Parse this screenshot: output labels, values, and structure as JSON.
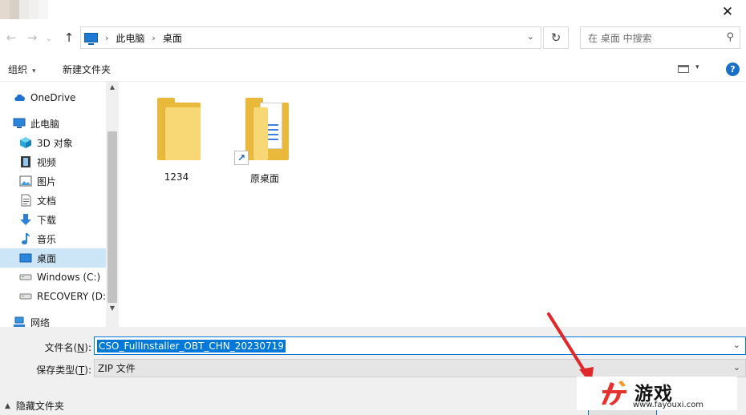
{
  "window": {
    "title_blur_colors": [
      "#e3d9cf",
      "#d8d0c7",
      "#ecebe8",
      "#f2f0ee",
      "#f6f6f6"
    ],
    "close_glyph": "✕"
  },
  "address_bar": {
    "back_glyph": "←",
    "forward_glyph": "→",
    "recent_glyph": "⌄",
    "up_glyph": "↑",
    "path": [
      "此电脑",
      "桌面"
    ],
    "separator": "›",
    "dropdown_glyph": "⌄",
    "refresh_glyph": "↻"
  },
  "search": {
    "placeholder": "在 桌面 中搜索",
    "icon": "search-icon",
    "icon_glyph": "⚲"
  },
  "toolbar": {
    "organize_label": "组织",
    "organize_caret": "▾",
    "new_folder_label": "新建文件夹",
    "view_caret": "▾",
    "help_glyph": "?"
  },
  "nav_pane": {
    "items": [
      {
        "label": "OneDrive",
        "icon": "cloud-icon"
      },
      {
        "label": "此电脑",
        "icon": "computer-icon"
      },
      {
        "label": "3D 对象",
        "icon": "3d-objects-icon"
      },
      {
        "label": "视频",
        "icon": "video-icon"
      },
      {
        "label": "图片",
        "icon": "pictures-icon"
      },
      {
        "label": "文档",
        "icon": "documents-icon"
      },
      {
        "label": "下载",
        "icon": "download-icon"
      },
      {
        "label": "音乐",
        "icon": "music-icon"
      },
      {
        "label": "桌面",
        "icon": "desktop-icon",
        "selected": true
      },
      {
        "label": "Windows (C:)",
        "icon": "drive-icon"
      },
      {
        "label": "RECOVERY (D:)",
        "icon": "drive-icon"
      },
      {
        "label": "网络",
        "icon": "network-icon"
      }
    ],
    "scroll_up_glyph": "▲",
    "scroll_down_glyph": "▼"
  },
  "files": [
    {
      "name": "1234",
      "icon": "folder-icon"
    },
    {
      "name": "原桌面",
      "icon": "folder-shortcut-icon",
      "shortcut_glyph": "↗"
    }
  ],
  "form": {
    "filename_label": "文件名(",
    "filename_key": "N",
    "filename_label_end": "):",
    "filename_value": "CSO_FullInstaller_OBT_CHN_20230719",
    "type_label": "保存类型(",
    "type_key": "T",
    "type_label_end": "):",
    "type_value": "ZIP 文件",
    "caret_glyph": "⌄",
    "hide_folders_caret": "▲",
    "hide_folders_label": "隐藏文件夹"
  },
  "watermark": {
    "title": "游戏",
    "url": "www.fayouxi.com"
  },
  "colors": {
    "accent": "#0078d7",
    "selection": "#cde6f7",
    "folder": "#f8d775",
    "arrow": "#e0282c"
  }
}
